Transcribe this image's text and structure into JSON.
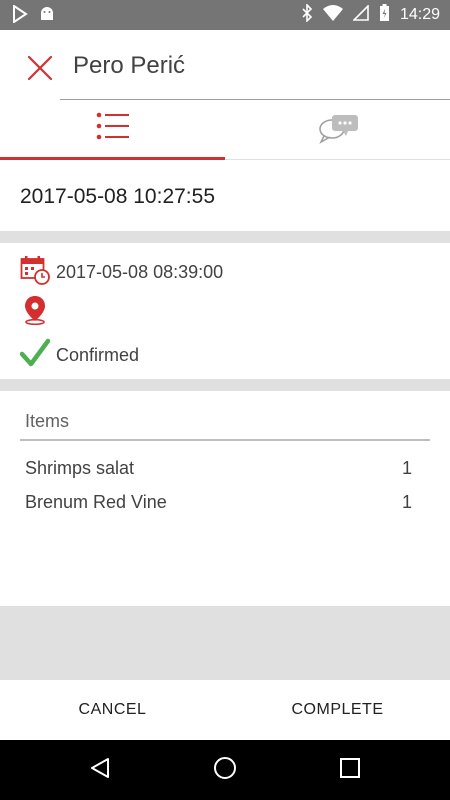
{
  "status_bar": {
    "time": "14:29"
  },
  "header": {
    "title": "Pero Perić"
  },
  "tabs": [
    {
      "icon": "list-icon",
      "active": true
    },
    {
      "icon": "chat-icon",
      "active": false
    }
  ],
  "order": {
    "datetime": "2017-05-08 10:27:55",
    "scheduled": "2017-05-08 08:39:00",
    "location": "",
    "status": "Confirmed"
  },
  "items": {
    "header": "Items",
    "rows": [
      {
        "name": "Shrimps salat",
        "qty": "1"
      },
      {
        "name": "Brenum Red Vine",
        "qty": "1"
      }
    ]
  },
  "actions": {
    "cancel": "CANCEL",
    "complete": "COMPLETE"
  },
  "colors": {
    "accent": "#d32f2f",
    "confirmed": "#4caf50",
    "status_bar": "#757575",
    "separator": "#e0e0e0"
  }
}
